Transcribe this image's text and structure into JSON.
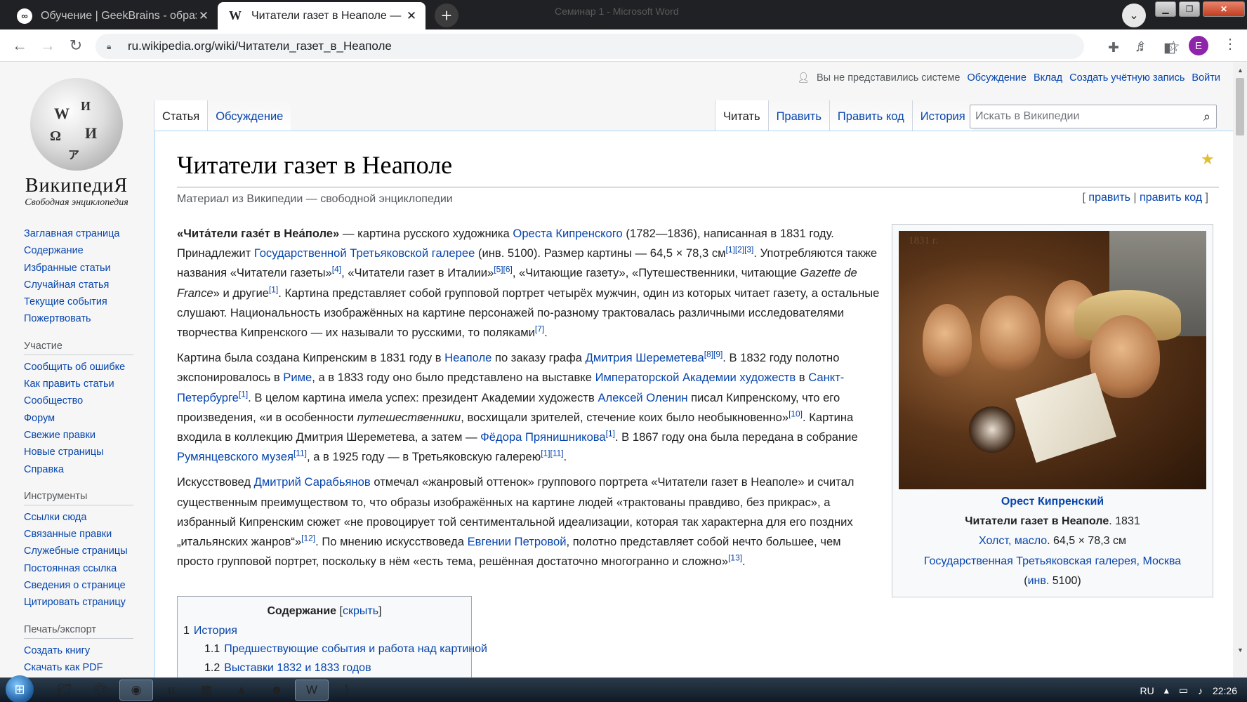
{
  "browser": {
    "tabs": [
      {
        "favicon": "∞",
        "title": "Обучение | GeekBrains - образо",
        "close": "✕"
      },
      {
        "favicon": "W",
        "title": "Читатели газет в Неаполе — Ви",
        "close": "✕"
      }
    ],
    "new_tab": "+",
    "ghost_title": "Семинар 1 - Microsoft Word",
    "url": "ru.wikipedia.org/wiki/Читатели_газет_в_Неаполе",
    "profile_initial": "E"
  },
  "wiki": {
    "logo_wordmark": "ВикипедиЯ",
    "logo_tagline": "Свободная энциклопедия",
    "personal": {
      "not_logged": "Вы не представились системе",
      "talk": "Обсуждение",
      "contrib": "Вклад",
      "create": "Создать учётную запись",
      "login": "Войти"
    },
    "tabs_left": [
      "Статья",
      "Обсуждение"
    ],
    "tabs_right": [
      "Читать",
      "Править",
      "Править код",
      "История"
    ],
    "search_placeholder": "Искать в Википедии",
    "sidebar": {
      "main": [
        "Заглавная страница",
        "Содержание",
        "Избранные статьи",
        "Случайная статья",
        "Текущие события",
        "Пожертвовать"
      ],
      "participation_heading": "Участие",
      "participation": [
        "Сообщить об ошибке",
        "Как править статьи",
        "Сообщество",
        "Форум",
        "Свежие правки",
        "Новые страницы",
        "Справка"
      ],
      "tools_heading": "Инструменты",
      "tools": [
        "Ссылки сюда",
        "Связанные правки",
        "Служебные страницы",
        "Постоянная ссылка",
        "Сведения о странице",
        "Цитировать страницу"
      ],
      "print_heading": "Печать/экспорт",
      "print": [
        "Создать книгу",
        "Скачать как PDF"
      ]
    },
    "title": "Читатели газет в Неаполе",
    "tagline": "Материал из Википедии — свободной энциклопедии",
    "edit_links": {
      "open": "[ ",
      "edit": "править",
      "sep": " | ",
      "edit_code": "править код",
      "close": " ]"
    },
    "p1": {
      "bold": "«Чита́тели газе́т в Неа́поле»",
      "t1": " — картина русского художника ",
      "l1": "Ореста Кипренского",
      "t2": " (1782—1836), написанная в 1831 году. Принадлежит ",
      "l2": "Государственной Третьяковской галерее",
      "t3": " (инв. 5100). Размер картины — 64,5 × 78,3 см",
      "r1": "[1][2][3]",
      "t4": ". Употребляются также названия «Читатели газеты»",
      "r2": "[4]",
      "t5": ", «Читатели газет в Италии»",
      "r3": "[5][6]",
      "t6": ", «Читающие газету», «Путешественники, читающие ",
      "i1": "Gazette de France",
      "t7": "» и другие",
      "r4": "[1]",
      "t8": ". Картина представляет собой групповой портрет четырёх мужчин, один из которых читает газету, а остальные слушают. Национальность изображённых на картине персонажей по-разному трактовалась различными исследователями творчества Кипренского — их называли то русскими, то поляками",
      "r5": "[7]",
      "t9": "."
    },
    "p2": {
      "t1": "Картина была создана Кипренским в 1831 году в ",
      "l1": "Неаполе",
      "t2": " по заказу графа ",
      "l2": "Дмитрия Шереметева",
      "r1": "[8][9]",
      "t3": ". В 1832 году полотно экспонировалось в ",
      "l3": "Риме",
      "t4": ", а в 1833 году оно было представлено на выставке ",
      "l4": "Императорской Академии художеств",
      "t5": " в ",
      "l5": "Санкт-Петербурге",
      "r2": "[1]",
      "t6": ". В целом картина имела успех: президент Академии художеств ",
      "l6": "Алексей Оленин",
      "t7": " писал Кипренскому, что его произведения, «и в особенности ",
      "i1": "путешественники",
      "t8": ", восхищали зрителей, стечение коих было необыкновенно»",
      "r3": "[10]",
      "t9": ". Картина входила в коллекцию Дмитрия Шереметева, а затем — ",
      "l7": "Фёдора Прянишникова",
      "r4": "[1]",
      "t10": ". В 1867 году она была передана в собрание ",
      "l8": "Румянцевского музея",
      "r5": "[11]",
      "t11": ", а в 1925 году — в Третьяковскую галерею",
      "r6": "[1][11]",
      "t12": "."
    },
    "p3": {
      "t1": "Искусствовед ",
      "l1": "Дмитрий Сарабьянов",
      "t2": " отмечал «жанровый оттенок» группового портрета «Читатели газет в Неаполе» и считал существенным преимуществом то, что образы изображённых на картине людей «трактованы правдиво, без прикрас», а избранный Кипренским сюжет «не провоцирует той сентиментальной идеализации, которая так характерна для его поздних „итальянских жанров“»",
      "r1": "[12]",
      "t3": ". По мнению искусствоведа ",
      "l2": "Евгении Петровой",
      "t4": ", полотно представляет собой нечто большее, чем просто групповой портрет, поскольку в нём «есть тема, решённая достаточно многогранно и сложно»",
      "r2": "[13]",
      "t5": "."
    },
    "infobox": {
      "painting_date": "1831 г.",
      "author": "Орест Кипренский",
      "work_title": "Читатели газет в Неаполе",
      "year": ". 1831",
      "medium": "Холст, масло",
      "size": ". 64,5 × 78,3 см",
      "museum": "Государственная Третьяковская галерея, Москва",
      "inv_open": "(",
      "inv": "инв.",
      "inv_num": " 5100)"
    },
    "toc": {
      "title": "Содержание",
      "toggle_open": " [",
      "toggle": "скрыть",
      "toggle_close": "]",
      "items": [
        {
          "num": "1",
          "label": "История"
        },
        {
          "num": "1.1",
          "label": "Предшествующие события и работа над картиной"
        },
        {
          "num": "1.2",
          "label": "Выставки 1832 и 1833 годов"
        }
      ]
    }
  },
  "taskbar": {
    "language": "RU",
    "time": "22:26"
  }
}
